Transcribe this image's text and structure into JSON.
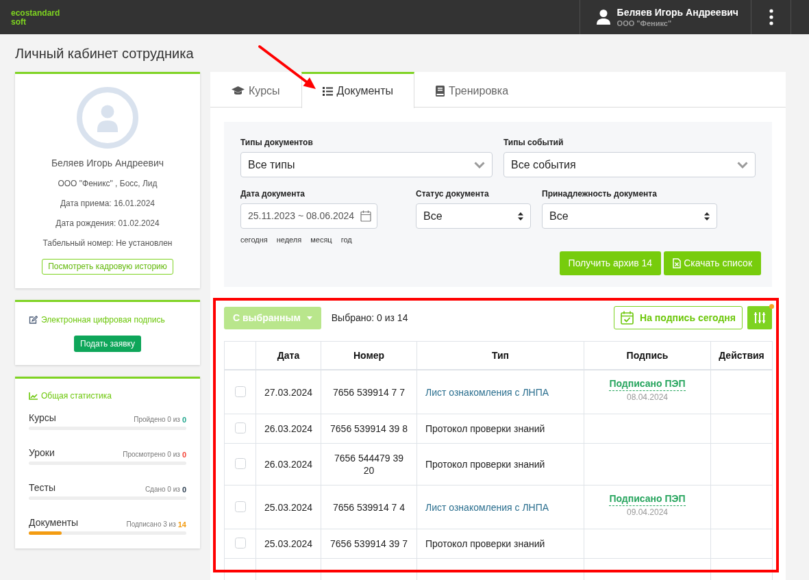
{
  "header": {
    "logo": [
      "ecostandard",
      "soft"
    ],
    "user": {
      "name": "Беляев Игорь Андреевич",
      "company": "ООО \"Феникс\""
    }
  },
  "page_title": "Личный кабинет сотрудника",
  "profile_card": {
    "name": "Беляев Игорь Андреевич",
    "details": [
      "ООО \"Феникс\" , Босс, Лид",
      "Дата приема: 16.01.2024",
      "Дата рождения: 01.02.2024",
      "Табельный номер: Не установлен"
    ],
    "history_button": "Посмотреть кадровую историю"
  },
  "signature_card": {
    "title": "Электронная цифровая подпись",
    "button": "Подать заявку"
  },
  "stats_card": {
    "title": "Общая статистика",
    "items": [
      {
        "label": "Курсы",
        "summary": "Пройдено 0 из",
        "total": "0",
        "color": "#1fa58c"
      },
      {
        "label": "Уроки",
        "summary": "Просмотрено 0 из",
        "total": "0",
        "color": "#f44336"
      },
      {
        "label": "Тесты",
        "summary": "Сдано 0 из",
        "total": "0",
        "color": "#2c3e50"
      },
      {
        "label": "Документы",
        "summary": "Подписано 3 из",
        "total": "14",
        "color": "#f39c12",
        "level": 0.21
      }
    ]
  },
  "tabs": [
    {
      "label": "Курсы",
      "selected": false
    },
    {
      "label": "Документы",
      "selected": true
    },
    {
      "label": "Тренировка",
      "selected": false
    }
  ],
  "filters": {
    "rows": [
      [
        {
          "kind": "dropdown",
          "label": "Типы документов",
          "value": "Все типы"
        },
        {
          "kind": "dropdown",
          "label": "Типы событий",
          "value": "Все события"
        }
      ],
      [
        {
          "kind": "daterange",
          "label": "Дата документа",
          "value": "25.11.2023 ~ 08.06.2024",
          "quick_ranges": [
            "сегодня",
            "неделя",
            "месяц",
            "год"
          ]
        },
        {
          "kind": "select",
          "label": "Статус документа",
          "value": "Все"
        },
        {
          "kind": "select",
          "label": "Принадлежность документа",
          "value": "Все"
        }
      ]
    ],
    "actions": [
      {
        "label": "Получить архив 14"
      },
      {
        "label": "Скачать список"
      }
    ]
  },
  "toolbar": {
    "bulk_button": {
      "label": "С выбранным",
      "disabled": true
    },
    "selection": "Выбрано: 0 из 14",
    "today_button": "На подпись сегодня",
    "settings_notification": true
  },
  "table": {
    "columns": [
      "Дата",
      "Номер",
      "Тип",
      "Подпись",
      "Действия"
    ],
    "rows": [
      {
        "checked": false,
        "date": "27.03.2024",
        "number": "7656 539914 7 7",
        "type": "Лист ознакомления с ЛНПА",
        "linked": true,
        "signature": {
          "status": "Подписано ПЭП",
          "date": "08.04.2024"
        }
      },
      {
        "checked": false,
        "date": "26.03.2024",
        "number": "7656 539914 39 8",
        "type": "Протокол проверки знаний",
        "linked": false
      },
      {
        "checked": false,
        "date": "26.03.2024",
        "number": "7656 544479 39 20",
        "type": "Протокол проверки знаний",
        "linked": false
      },
      {
        "checked": false,
        "date": "25.03.2024",
        "number": "7656 539914 7 4",
        "type": "Лист ознакомления с ЛНПА",
        "linked": true,
        "signature": {
          "status": "Подписано ПЭП",
          "date": "09.04.2024"
        }
      },
      {
        "checked": false,
        "date": "25.03.2024",
        "number": "7656 539914 39 7",
        "type": "Протокол проверки знаний",
        "linked": false
      }
    ]
  },
  "annotations": {
    "arrow": true,
    "highlight_frame": true
  }
}
